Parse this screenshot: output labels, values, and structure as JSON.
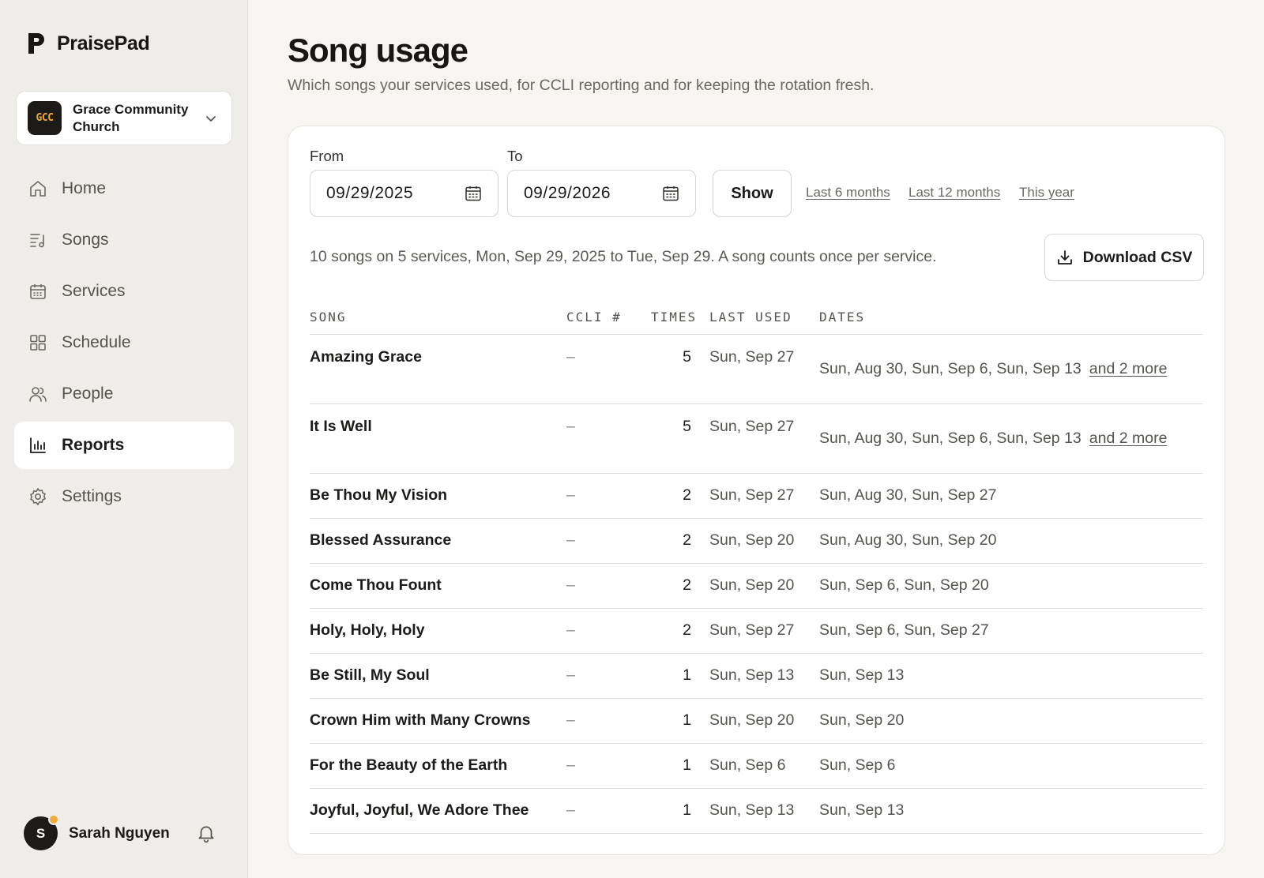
{
  "brand": {
    "name": "PraisePad"
  },
  "org": {
    "initials": "GCC",
    "name": "Grace Community Church"
  },
  "nav": [
    {
      "label": "Home",
      "icon": "home-icon"
    },
    {
      "label": "Songs",
      "icon": "songs-icon"
    },
    {
      "label": "Services",
      "icon": "calendar-icon"
    },
    {
      "label": "Schedule",
      "icon": "grid-icon"
    },
    {
      "label": "People",
      "icon": "people-icon"
    },
    {
      "label": "Reports",
      "icon": "bar-chart-icon",
      "active": true
    },
    {
      "label": "Settings",
      "icon": "gear-icon"
    }
  ],
  "user": {
    "initial": "S",
    "name": "Sarah Nguyen"
  },
  "page": {
    "title": "Song usage",
    "subtitle": "Which songs your services used, for CCLI reporting and for keeping the rotation fresh."
  },
  "filters": {
    "from_label": "From",
    "from_value": "09/29/2025",
    "to_label": "To",
    "to_value": "09/29/2026",
    "show_label": "Show",
    "quick_ranges": [
      "Last 6 months",
      "Last 12 months",
      "This year"
    ]
  },
  "summary": "10 songs on 5 services, Mon, Sep 29, 2025 to Tue, Sep 29. A song counts once per service.",
  "download_label": "Download CSV",
  "table": {
    "headers": {
      "song": "SONG",
      "ccli": "CCLI #",
      "times": "TIMES",
      "last": "LAST USED",
      "dates": "DATES"
    },
    "rows": [
      {
        "song": "Amazing Grace",
        "ccli": "–",
        "times": "5",
        "last": "Sun, Sep 27",
        "dates": "Sun, Aug 30, Sun, Sep 6, Sun, Sep 13",
        "more": "and 2 more"
      },
      {
        "song": "It Is Well",
        "ccli": "–",
        "times": "5",
        "last": "Sun, Sep 27",
        "dates": "Sun, Aug 30, Sun, Sep 6, Sun, Sep 13",
        "more": "and 2 more"
      },
      {
        "song": "Be Thou My Vision",
        "ccli": "–",
        "times": "2",
        "last": "Sun, Sep 27",
        "dates": "Sun, Aug 30, Sun, Sep 27"
      },
      {
        "song": "Blessed Assurance",
        "ccli": "–",
        "times": "2",
        "last": "Sun, Sep 20",
        "dates": "Sun, Aug 30, Sun, Sep 20"
      },
      {
        "song": "Come Thou Fount",
        "ccli": "–",
        "times": "2",
        "last": "Sun, Sep 20",
        "dates": "Sun, Sep 6, Sun, Sep 20"
      },
      {
        "song": "Holy, Holy, Holy",
        "ccli": "–",
        "times": "2",
        "last": "Sun, Sep 27",
        "dates": "Sun, Sep 6, Sun, Sep 27"
      },
      {
        "song": "Be Still, My Soul",
        "ccli": "–",
        "times": "1",
        "last": "Sun, Sep 13",
        "dates": "Sun, Sep 13"
      },
      {
        "song": "Crown Him with Many Crowns",
        "ccli": "–",
        "times": "1",
        "last": "Sun, Sep 20",
        "dates": "Sun, Sep 20"
      },
      {
        "song": "For the Beauty of the Earth",
        "ccli": "–",
        "times": "1",
        "last": "Sun, Sep 6",
        "dates": "Sun, Sep 6"
      },
      {
        "song": "Joyful, Joyful, We Adore Thee",
        "ccli": "–",
        "times": "1",
        "last": "Sun, Sep 13",
        "dates": "Sun, Sep 13"
      }
    ]
  },
  "colors": {
    "accent": "#f0a93a",
    "sidebar_bg": "#eeede9",
    "page_bg": "#f6f5f2",
    "text": "#1c1b19"
  }
}
